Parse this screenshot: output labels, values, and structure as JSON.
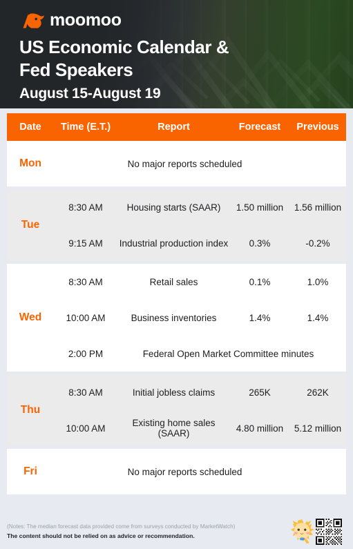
{
  "brand": {
    "name": "moomoo",
    "logo_icon": "moomoo-bull-logo-icon",
    "accent_color": "#fa6400",
    "header_bg_color": "#2b2f33",
    "header_accent_color": "#2b4a22"
  },
  "header": {
    "title": "US Economic Calendar &\nFed Speakers",
    "subtitle": "August 15-August 19"
  },
  "table": {
    "columns": {
      "date": "Date",
      "time": "Time (E.T.)",
      "report": "Report",
      "forecast": "Forecast",
      "previous": "Previous"
    },
    "days": [
      {
        "day": "Mon",
        "empty_text": "No major reports scheduled",
        "rows": []
      },
      {
        "day": "Tue",
        "rows": [
          {
            "time": "8:30 AM",
            "report": "Housing starts (SAAR)",
            "forecast": "1.50 million",
            "previous": "1.56 million"
          },
          {
            "time": "9:15 AM",
            "report": "Industrial production index",
            "forecast": "0.3%",
            "previous": "-0.2%"
          }
        ]
      },
      {
        "day": "Wed",
        "rows": [
          {
            "time": "8:30 AM",
            "report": "Retail sales",
            "forecast": "0.1%",
            "previous": "1.0%"
          },
          {
            "time": "10:00 AM",
            "report": "Business inventories",
            "forecast": "1.4%",
            "previous": "1.4%"
          },
          {
            "time": "2:00 PM",
            "report": "Federal Open Market Committee minutes",
            "forecast": "",
            "previous": "",
            "span": true
          }
        ]
      },
      {
        "day": "Thu",
        "rows": [
          {
            "time": "8:30 AM",
            "report": "Initial jobless claims",
            "forecast": "265K",
            "previous": "262K"
          },
          {
            "time": "10:00 AM",
            "report": "Existing home sales (SAAR)",
            "forecast": "4.80 million",
            "previous": "5.12 million"
          }
        ]
      },
      {
        "day": "Fri",
        "empty_text": "No major reports scheduled",
        "rows": []
      }
    ]
  },
  "watermark": {
    "text": "moomoo"
  },
  "footer": {
    "note": "(Notes: The median forecast data provided come from surveys conducted by MarketWatch)",
    "disclaimer": "The content should not be relied on as advice or recommendation.",
    "mascot_icon": "moomoo-mascot-icon",
    "qr_icon": "qr-code-icon"
  }
}
